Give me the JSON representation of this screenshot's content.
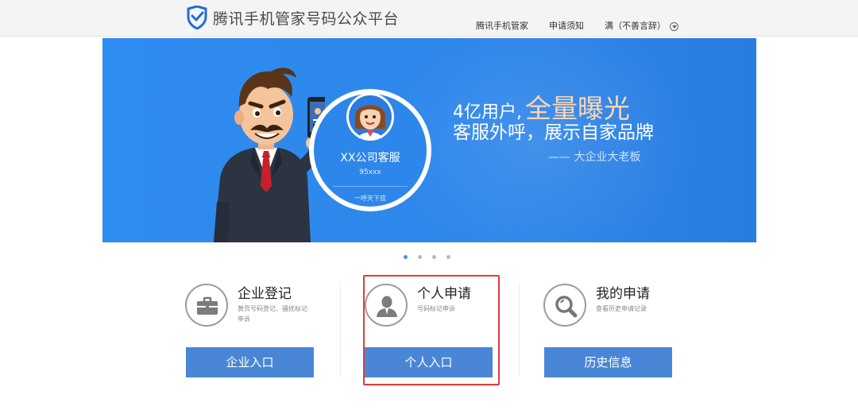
{
  "header": {
    "logo_text": "腾讯手机管家号码公众平台",
    "nav": [
      {
        "label": "腾讯手机管家"
      },
      {
        "label": "申请须知"
      },
      {
        "label": "满（不善言辞）"
      }
    ]
  },
  "banner": {
    "card_name": "XX公司客服",
    "card_number": "95xxx",
    "card_call": "一呼天下应",
    "tagline_prefix": "4亿用户,",
    "tagline_highlight": "全量曝光",
    "tagline_line2": "客服外呼，展示自家品牌",
    "tagline_line3": "—— 大企业大老板",
    "dots": 4,
    "active_dot": 1
  },
  "sections": [
    {
      "title": "企业登记",
      "desc": "黄页号码登记、骚扰标记申诉",
      "button": "企业入口",
      "icon": "briefcase-icon"
    },
    {
      "title": "个人申请",
      "desc": "号码标记申诉",
      "button": "个人入口",
      "icon": "person-icon"
    },
    {
      "title": "我的申请",
      "desc": "查看历史申请记录",
      "button": "历史信息",
      "icon": "magnifier-icon"
    }
  ],
  "colors": {
    "banner_blue": "#2e86ea",
    "button_blue": "#4a86d6",
    "highlight_red": "#e23b3b",
    "tagline_accent": "#ffd6b0"
  }
}
